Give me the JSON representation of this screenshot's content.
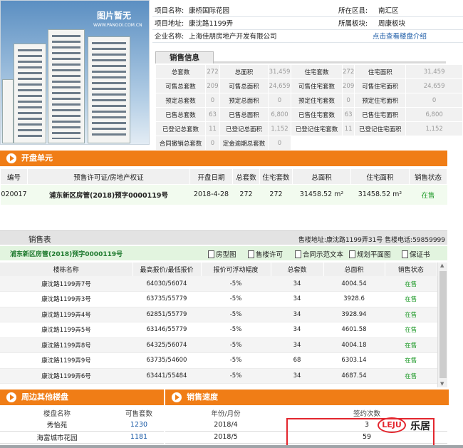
{
  "image": {
    "caption": "图片暂无",
    "url": "WWW.PANGOI.COM.CN"
  },
  "info": {
    "r1": {
      "l1": "项目名称:",
      "v1": "康桥国际花园",
      "l2": "所在区县:",
      "v2": "南汇区"
    },
    "r2": {
      "l1": "项目地址:",
      "v1": "康沈路1199弄",
      "l2": "所属板块:",
      "v2": "周康板块"
    },
    "r3": {
      "l1": "企业名称:",
      "v1": "上海佳朋房地产开发有限公司",
      "link": "点击查看楼盘介绍"
    }
  },
  "sales_tab": "销售信息",
  "sales_grid": [
    [
      "总套数",
      "272",
      "总面积",
      "31,459",
      "住宅套数",
      "272",
      "住宅面积",
      "31,459"
    ],
    [
      "可售总套数",
      "209",
      "可售总面积",
      "24,659",
      "可售住宅套数",
      "209",
      "可售住宅面积",
      "24,659"
    ],
    [
      "预定总套数",
      "0",
      "预定总面积",
      "0",
      "预定住宅套数",
      "0",
      "预定住宅面积",
      "0"
    ],
    [
      "已售总套数",
      "63",
      "已售总面积",
      "6,800",
      "已售住宅套数",
      "63",
      "已售住宅面积",
      "6,800"
    ],
    [
      "已登记总套数",
      "11",
      "已登记总面积",
      "1,152",
      "已登记住宅套数",
      "11",
      "已登记住宅面积",
      "1,152"
    ],
    [
      "合同撤销总套数",
      "0",
      "定金逾期总套数",
      "0",
      "",
      "",
      "",
      ""
    ]
  ],
  "kaipan": {
    "title": "开盘单元",
    "headers": [
      "编号",
      "预售许可证/房地产权证",
      "开盘日期",
      "总套数",
      "住宅套数",
      "总面积",
      "住宅面积",
      "销售状态"
    ],
    "row": [
      "020017",
      "浦东新区房管(2018)预字0000119号",
      "2018-4-28",
      "272",
      "272",
      "31458.52 m²",
      "31458.52 m²",
      "在售"
    ]
  },
  "sales_table": {
    "title": "销售表",
    "address": "售楼地址:康沈路1199弄31号 售楼电话:59859999",
    "permit": "浦东新区房管(2018)预字0000119号",
    "buttons": [
      "房型图",
      "售楼许可",
      "合同示范文本",
      "规划平面图",
      "保证书"
    ],
    "headers": [
      "楼栋名称",
      "最高报价/最低报价",
      "报价可浮动幅度",
      "总套数",
      "总面积",
      "销售状态"
    ],
    "rows": [
      [
        "康沈路1199弄7号",
        "64030/56074",
        "-5%",
        "34",
        "4004.54",
        "在售"
      ],
      [
        "康沈路1199弄3号",
        "63735/55779",
        "-5%",
        "34",
        "3928.6",
        "在售"
      ],
      [
        "康沈路1199弄4号",
        "62851/55779",
        "-5%",
        "34",
        "3928.94",
        "在售"
      ],
      [
        "康沈路1199弄5号",
        "63146/55779",
        "-5%",
        "34",
        "4601.58",
        "在售"
      ],
      [
        "康沈路1199弄8号",
        "64325/56074",
        "-5%",
        "34",
        "4004.18",
        "在售"
      ],
      [
        "康沈路1199弄9号",
        "63735/54600",
        "-5%",
        "68",
        "6303.14",
        "在售"
      ],
      [
        "康沈路1199弄6号",
        "63441/55484",
        "-5%",
        "34",
        "4687.54",
        "在售"
      ]
    ]
  },
  "nearby": {
    "title": "周边其他楼盘",
    "h1": "楼盘名称",
    "h2": "可售套数",
    "rows": [
      [
        "秀怡苑",
        "1230"
      ],
      [
        "海富城市花园",
        "1181"
      ]
    ]
  },
  "speed": {
    "title": "销售速度",
    "h1": "年份/月份",
    "h2": "签约次数",
    "rows": [
      [
        "2018/4",
        "3"
      ],
      [
        "2018/5",
        "59"
      ]
    ]
  },
  "logo": {
    "mark": "LEJU",
    "text": "乐居"
  }
}
